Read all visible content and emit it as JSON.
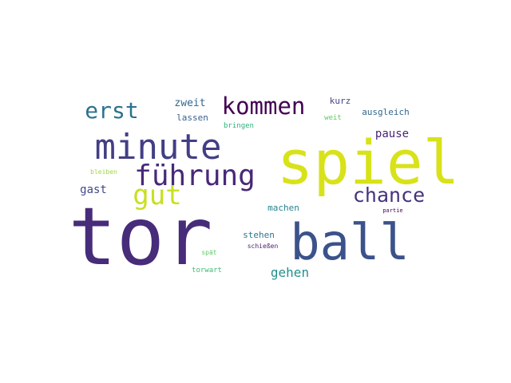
{
  "word_cloud": {
    "words": [
      {
        "text": "tor",
        "color": "#472c7a"
      },
      {
        "text": "spiel",
        "color": "#d8e219"
      },
      {
        "text": "ball",
        "color": "#3b528b"
      },
      {
        "text": "minute",
        "color": "#433e85"
      },
      {
        "text": "führung",
        "color": "#482878"
      },
      {
        "text": "kommen",
        "color": "#440154"
      },
      {
        "text": "erst",
        "color": "#2c728e"
      },
      {
        "text": "gut",
        "color": "#c8e020"
      },
      {
        "text": "chance",
        "color": "#46337e"
      },
      {
        "text": "gast",
        "color": "#3e4989"
      },
      {
        "text": "pause",
        "color": "#482475"
      },
      {
        "text": "gehen",
        "color": "#21918c"
      },
      {
        "text": "zweit",
        "color": "#31688e"
      },
      {
        "text": "lassen",
        "color": "#355f8d"
      },
      {
        "text": "bringen",
        "color": "#2db27d"
      },
      {
        "text": "kurz",
        "color": "#414487"
      },
      {
        "text": "weit",
        "color": "#5ec962"
      },
      {
        "text": "ausgleich",
        "color": "#31688e"
      },
      {
        "text": "machen",
        "color": "#26828e"
      },
      {
        "text": "stehen",
        "color": "#2a788e"
      },
      {
        "text": "schießen",
        "color": "#481f70"
      },
      {
        "text": "spät",
        "color": "#5ec962"
      },
      {
        "text": "torwart",
        "color": "#3fbc73"
      },
      {
        "text": "bleiben",
        "color": "#a0da39"
      },
      {
        "text": "partie",
        "color": "#440154"
      }
    ]
  }
}
